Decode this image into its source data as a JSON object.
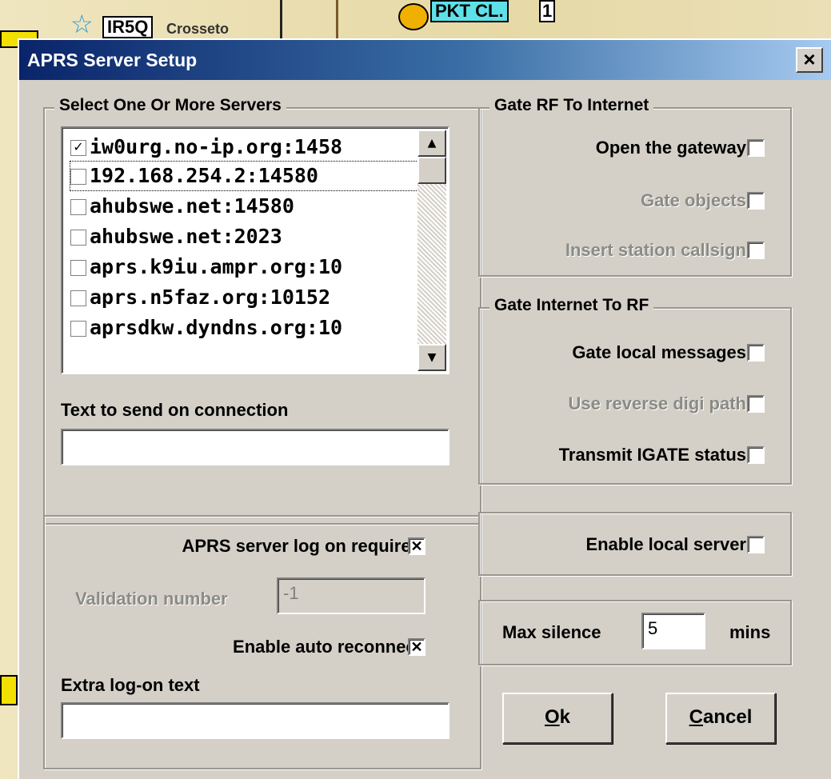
{
  "map": {
    "label_1": "IR5Q",
    "label_1_suffix": "Crosseto",
    "label_2": "PKT CL.",
    "label_2_suffix": "1"
  },
  "dialog": {
    "title": "APRS Server Setup",
    "close_label": "×"
  },
  "servers": {
    "legend": "Select One Or More Servers",
    "items": [
      {
        "label": "iw0urg.no-ip.org:1458",
        "checked": true
      },
      {
        "label": "192.168.254.2:14580",
        "checked": false
      },
      {
        "label": "ahubswe.net:14580",
        "checked": false
      },
      {
        "label": "ahubswe.net:2023",
        "checked": false
      },
      {
        "label": "aprs.k9iu.ampr.org:10",
        "checked": false
      },
      {
        "label": "aprs.n5faz.org:10152",
        "checked": false
      },
      {
        "label": "aprsdkw.dyndns.org:10",
        "checked": false
      }
    ],
    "scroll_up": "▲",
    "scroll_down": "▼",
    "text_on_connection_label": "Text to send on connection",
    "text_on_connection_value": ""
  },
  "gate_rf": {
    "legend": "Gate RF To Internet",
    "open_gateway": "Open the gateway",
    "gate_objects": "Gate objects",
    "insert_callsign": "Insert station callsign"
  },
  "gate_inet": {
    "legend": "Gate Internet To RF",
    "local_messages": "Gate local messages",
    "reverse_digi": "Use reverse digi path",
    "igate_status": "Transmit IGATE status"
  },
  "logon": {
    "log_on_required": "APRS server log on required",
    "log_on_required_mark": "✕",
    "validation_label": "Validation number",
    "validation_value": "-1",
    "auto_reconnect": "Enable auto reconnect",
    "auto_reconnect_mark": "✕",
    "extra_label": "Extra log-on text",
    "extra_value": ""
  },
  "local_server": {
    "label": "Enable local server"
  },
  "silence": {
    "label": "Max silence",
    "value": "5",
    "unit": "mins"
  },
  "buttons": {
    "ok_accel": "O",
    "ok_rest": "k",
    "cancel_accel": "C",
    "cancel_rest": "ancel"
  }
}
